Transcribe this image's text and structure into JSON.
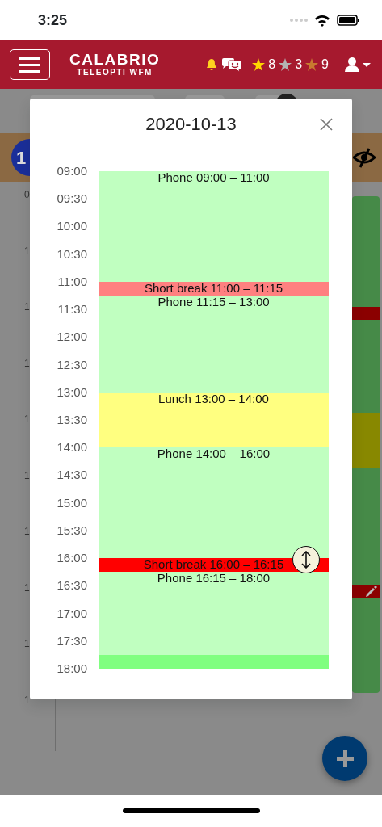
{
  "status_bar": {
    "time": "3:25"
  },
  "header": {
    "logo_title": "CALABRIO",
    "logo_subtitle": "TELEOPTI WFM",
    "badges": [
      {
        "count": "8",
        "color": "#ffd700"
      },
      {
        "count": "3",
        "color": "#b4b4b4"
      },
      {
        "count": "9",
        "color": "#c87a30"
      }
    ]
  },
  "background": {
    "toolbar_toggle": {
      "on": true
    },
    "day_badge": "1",
    "gutter_labels": [
      "0",
      "1",
      "1",
      "1",
      "1",
      "1",
      "1",
      "1",
      "1",
      "1"
    ]
  },
  "dialog": {
    "title": "2020-10-13",
    "times": [
      "09:00",
      "09:30",
      "10:00",
      "10:30",
      "11:00",
      "11:30",
      "12:00",
      "12:30",
      "13:00",
      "13:30",
      "14:00",
      "14:30",
      "15:00",
      "15:30",
      "16:00",
      "16:30",
      "17:00",
      "17:30",
      "18:00"
    ],
    "activities": [
      {
        "kind": "activity",
        "name": "Phone",
        "start": "09:00",
        "dash": "–",
        "end": "11:00",
        "color": "#c0ffc0"
      },
      {
        "kind": "activity",
        "name": "Short break",
        "start": "11:00",
        "dash": "–",
        "end": "11:15",
        "color": "#ff8080"
      },
      {
        "kind": "activity",
        "name": "Phone",
        "start": "11:15",
        "dash": "–",
        "end": "13:00",
        "color": "#c0ffc0"
      },
      {
        "kind": "activity",
        "name": "Lunch",
        "start": "13:00",
        "dash": "–",
        "end": "14:00",
        "color": "#ffff80"
      },
      {
        "kind": "activity",
        "name": "Phone",
        "start": "14:00",
        "dash": "–",
        "end": "16:00",
        "color": "#c0ffc0"
      },
      {
        "kind": "activity",
        "name": "Short break",
        "start": "16:00",
        "dash": "–",
        "end": "16:15",
        "color": "#ff0000"
      },
      {
        "kind": "activity",
        "name": "Phone",
        "start": "16:15",
        "dash": "–",
        "end": "18:00",
        "color": "#c0ffc0"
      },
      {
        "kind": "end_marker",
        "color": "#80ff80"
      }
    ]
  }
}
